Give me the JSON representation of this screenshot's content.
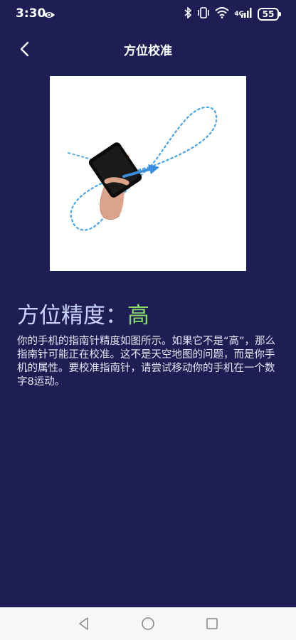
{
  "status_bar": {
    "time": "3:30",
    "network_type": "4G",
    "battery_level": "55",
    "icons": [
      "eye-icon",
      "bluetooth-icon",
      "vibrate-icon",
      "wifi-icon",
      "cellular-signal-icon",
      "battery-icon"
    ]
  },
  "header": {
    "title": "方位校准",
    "back_icon": "chevron-left-icon"
  },
  "illustration": {
    "description_icon": "figure-eight-calibration-illustration"
  },
  "accuracy": {
    "label": "方位精度：",
    "value": "高",
    "value_color": "#8bd96b"
  },
  "description": "你的手机的指南针精度如图所示。如果它不是“高”，那么指南针可能正在校准。这不是天空地图的问题，而是你手机的属性。要校准指南针，请尝试移动你的手机在一个数字8运动。",
  "nav_bar": {
    "icons": [
      "back-triangle-icon",
      "home-circle-icon",
      "recents-square-icon"
    ]
  },
  "colors": {
    "background": "#1f1e54",
    "nav_background": "#f7f7f7"
  }
}
